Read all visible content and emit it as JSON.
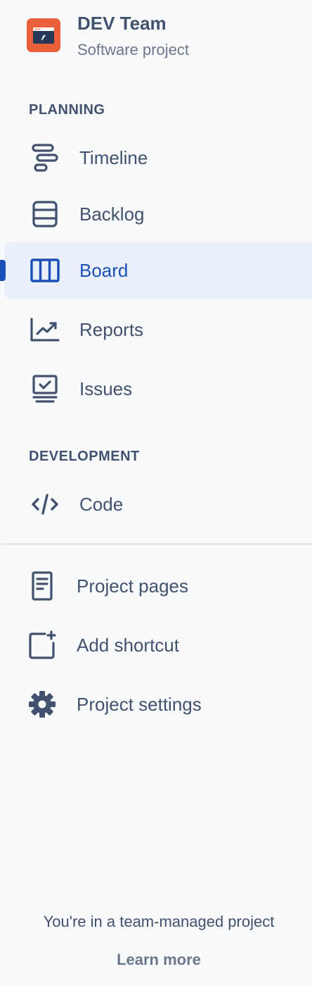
{
  "project": {
    "name": "DEV Team",
    "type": "Software project",
    "avatar_icon": "rocket-window-icon",
    "avatar_color": "#e8613b"
  },
  "sections": {
    "planning": "PLANNING",
    "development": "DEVELOPMENT"
  },
  "nav": {
    "timeline": {
      "label": "Timeline",
      "icon": "timeline-icon"
    },
    "backlog": {
      "label": "Backlog",
      "icon": "backlog-icon"
    },
    "board": {
      "label": "Board",
      "icon": "board-icon",
      "active": true
    },
    "reports": {
      "label": "Reports",
      "icon": "reports-icon"
    },
    "issues": {
      "label": "Issues",
      "icon": "issues-icon"
    },
    "code": {
      "label": "Code",
      "icon": "code-icon"
    },
    "project_pages": {
      "label": "Project pages",
      "icon": "page-icon"
    },
    "add_shortcut": {
      "label": "Add shortcut",
      "icon": "add-shortcut-icon"
    },
    "project_settings": {
      "label": "Project settings",
      "icon": "gear-icon"
    }
  },
  "footer": {
    "message": "You're in a team-managed project",
    "learn_more": "Learn more"
  },
  "colors": {
    "active_accent": "#1a4fb8",
    "active_background": "#e9f0fb",
    "text": "#42526e",
    "muted_text": "#6b778c"
  }
}
